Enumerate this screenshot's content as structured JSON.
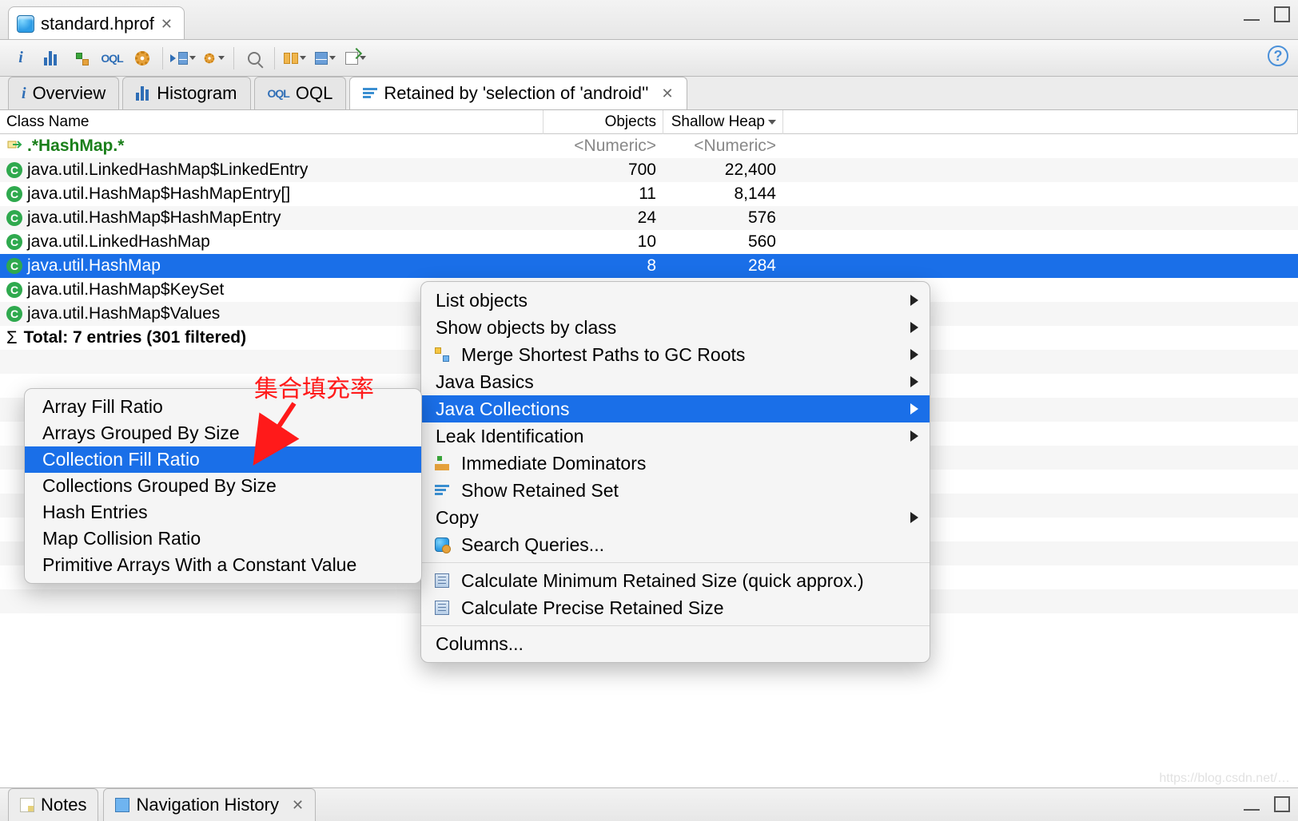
{
  "file_tab": {
    "title": "standard.hprof"
  },
  "inner_tabs": {
    "t0": "Overview",
    "t1": "Histogram",
    "t2": "OQL",
    "t3": "Retained by 'selection of 'android''"
  },
  "table": {
    "headers": {
      "c0": "Class Name",
      "c1": "Objects",
      "c2": "Shallow Heap"
    },
    "filter": {
      "c0": ".*HashMap.*",
      "c1": "<Numeric>",
      "c2": "<Numeric>"
    },
    "rows": [
      {
        "name": "java.util.LinkedHashMap$LinkedEntry",
        "objects": "700",
        "heap": "22,400"
      },
      {
        "name": "java.util.HashMap$HashMapEntry[]",
        "objects": "11",
        "heap": "8,144"
      },
      {
        "name": "java.util.HashMap$HashMapEntry",
        "objects": "24",
        "heap": "576"
      },
      {
        "name": "java.util.LinkedHashMap",
        "objects": "10",
        "heap": "560"
      },
      {
        "name": "java.util.HashMap",
        "objects": "8",
        "heap": "284"
      },
      {
        "name": "java.util.HashMap$KeySet",
        "objects": "",
        "heap": ""
      },
      {
        "name": "java.util.HashMap$Values",
        "objects": "",
        "heap": ""
      }
    ],
    "total": "Total: 7 entries (301 filtered)"
  },
  "context_menu": {
    "m0": "List objects",
    "m1": "Show objects by class",
    "m2": "Merge Shortest Paths to GC Roots",
    "m3": "Java Basics",
    "m4": "Java Collections",
    "m5": "Leak Identification",
    "m6": "Immediate Dominators",
    "m7": "Show Retained Set",
    "m8": "Copy",
    "m9": "Search Queries...",
    "m10": "Calculate Minimum Retained Size (quick approx.)",
    "m11": "Calculate Precise Retained Size",
    "m12": "Columns..."
  },
  "submenu": {
    "s0": "Array Fill Ratio",
    "s1": "Arrays Grouped By Size",
    "s2": "Collection Fill Ratio",
    "s3": "Collections Grouped By Size",
    "s4": "Hash Entries",
    "s5": "Map Collision Ratio",
    "s6": "Primitive Arrays With a Constant Value"
  },
  "annotation": "集合填充率",
  "bottom": {
    "notes": "Notes",
    "nav": "Navigation History"
  },
  "help": "?"
}
